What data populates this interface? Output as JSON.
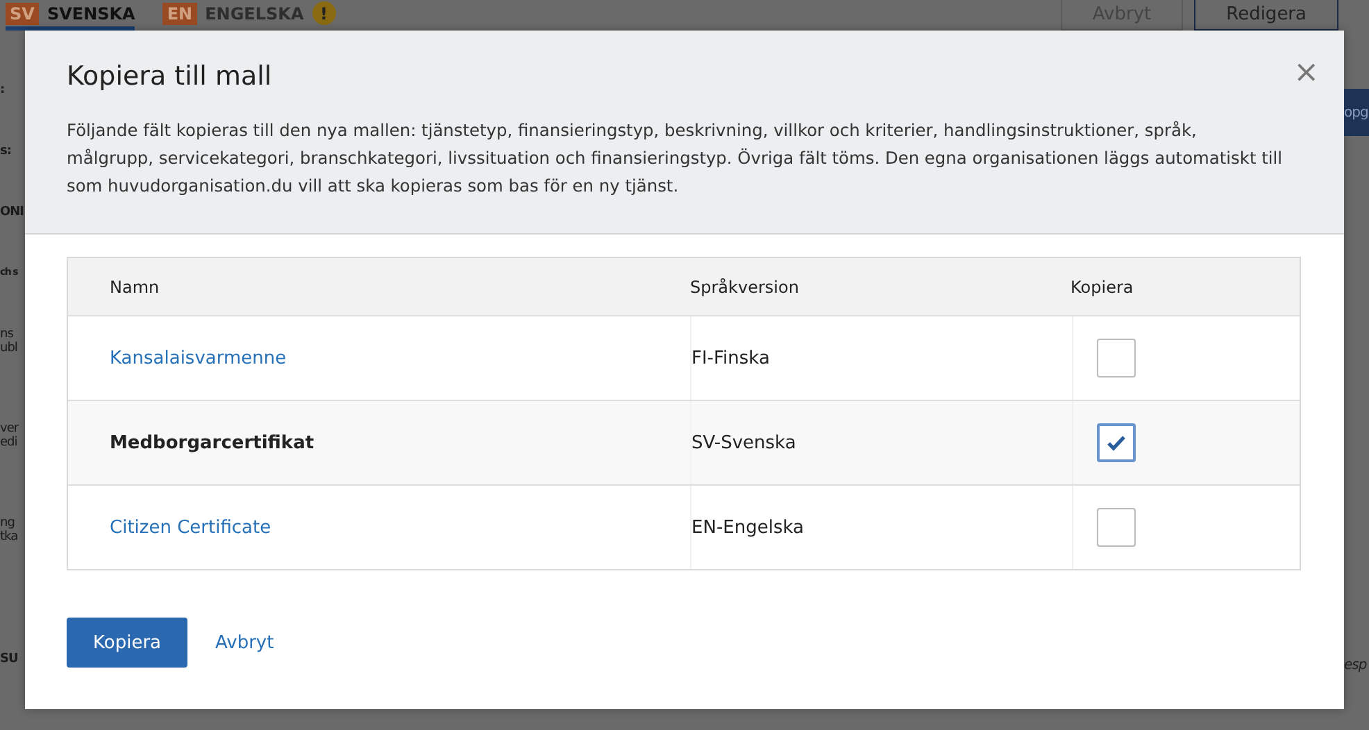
{
  "background": {
    "language_tabs": [
      {
        "code": "SV",
        "label": "SVENSKA",
        "selected": true,
        "warning": false
      },
      {
        "code": "EN",
        "label": "ENGELSKA",
        "selected": false,
        "warning": true
      }
    ],
    "warning_mark": "!",
    "buttons": [
      "Avbryt",
      "Redigera"
    ],
    "left_fragments": [
      [
        ":"
      ],
      [
        "s:"
      ],
      [
        "ONI"
      ],
      [
        "ch s"
      ],
      [
        "ns",
        "ubl"
      ],
      [
        "ver",
        "edi"
      ],
      [
        "ng",
        "tka"
      ],
      [
        "SU"
      ]
    ],
    "right_fragments": [
      "opg",
      "esp"
    ]
  },
  "dialog": {
    "title": "Kopiera till mall",
    "close": "×",
    "description": "Följande fält kopieras till den nya mallen: tjänstetyp, finansieringstyp, beskrivning, villkor och kriterier, handlingsinstruktioner, språk, målgrupp, servicekategori, branschkategori, livssituation och finansieringstyp. Övriga fält töms. Den egna organisationen läggs automatiskt till som huvudorganisation.du vill att ska kopieras som bas för en ny tjänst.",
    "table": {
      "columns": [
        "Namn",
        "Språkversion",
        "Kopiera"
      ],
      "rows": [
        {
          "name": "Kansalaisvarmenne",
          "language": "FI-Finska",
          "current": false,
          "checked": false
        },
        {
          "name": "Medborgarcertifikat",
          "language": "SV-Svenska",
          "current": true,
          "checked": true
        },
        {
          "name": "Citizen Certificate",
          "language": "EN-Engelska",
          "current": false,
          "checked": false
        }
      ]
    },
    "primary_button": "Kopiera",
    "cancel_link": "Avbryt"
  }
}
